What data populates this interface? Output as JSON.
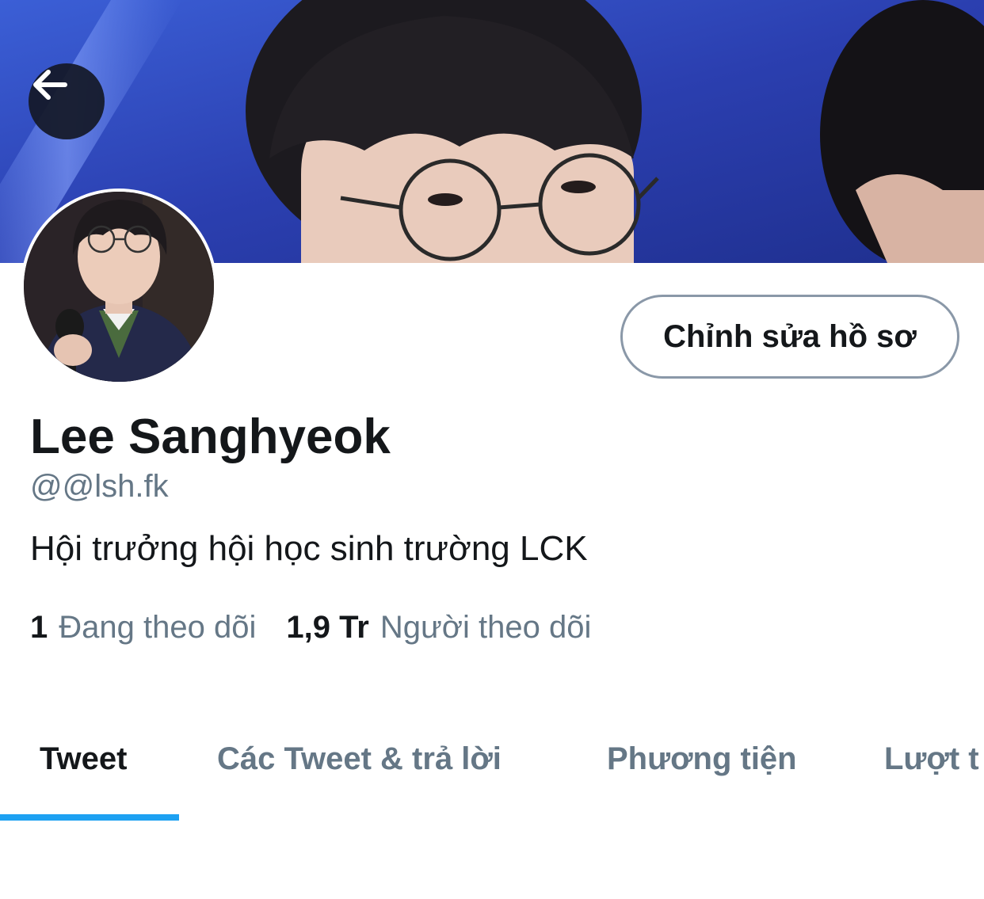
{
  "header": {
    "back_icon": "arrow-left-icon"
  },
  "profile": {
    "edit_button_label": "Chỉnh sửa hồ sơ",
    "display_name": "Lee Sanghyeok",
    "handle": "@@lsh.fk",
    "bio": "Hội trưởng hội học sinh trường LCK",
    "following_count": "1",
    "following_label": "Đang theo dõi",
    "followers_count": "1,9 Tr",
    "followers_label": "Người theo dõi"
  },
  "tabs": [
    {
      "label": "Tweet",
      "active": true
    },
    {
      "label": "Các Tweet & trả lời",
      "active": false
    },
    {
      "label": "Phương tiện",
      "active": false
    },
    {
      "label": "Lượt t",
      "active": false
    }
  ],
  "colors": {
    "accent": "#1da1f2",
    "text_primary": "#14171a",
    "text_secondary": "#657786",
    "border": "#8a98a8",
    "banner_blue": "#2a3fb4"
  }
}
